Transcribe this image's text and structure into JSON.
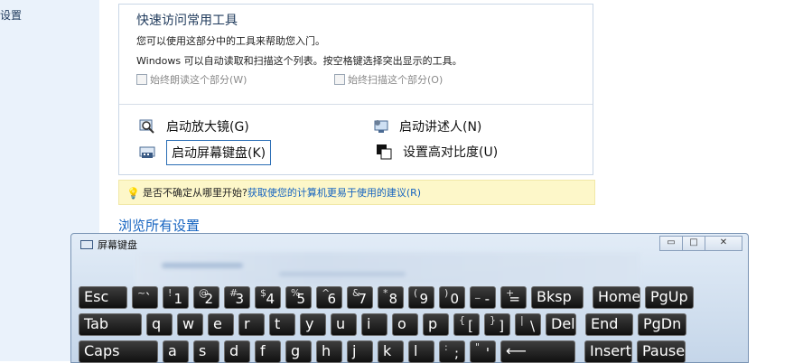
{
  "sidebar": {
    "label": "设置"
  },
  "quick_access": {
    "title": "快速访问常用工具",
    "line1": "您可以使用这部分中的工具来帮助您入门。",
    "line2": "Windows 可以自动读取和扫描这个列表。按空格键选择突出显示的工具。",
    "option_read": "始终朗读这个部分(W)",
    "option_scan": "始终扫描这个部分(O)",
    "tools": {
      "magnifier": "启动放大镜(G)",
      "narrator": "启动讲述人(N)",
      "osk": "启动屏幕键盘(K)",
      "contrast": "设置高对比度(U)"
    }
  },
  "hint": {
    "question": "是否不确定从哪里开始?",
    "link": "获取使您的计算机更易于使用的建议(R)"
  },
  "browse_all": "浏览所有设置",
  "osk_window": {
    "title": "屏幕键盘",
    "btn_min": "▭",
    "btn_max": "□",
    "btn_close": "✕"
  },
  "keyboard": {
    "row1": [
      {
        "top": "",
        "main": "Esc"
      },
      {
        "top": "~",
        "bot": "`"
      },
      {
        "top": "!",
        "bot": "1"
      },
      {
        "top": "@",
        "bot": "2"
      },
      {
        "top": "#",
        "bot": "3"
      },
      {
        "top": "$",
        "bot": "4"
      },
      {
        "top": "%",
        "bot": "5"
      },
      {
        "top": "^",
        "bot": "6"
      },
      {
        "top": "&",
        "bot": "7"
      },
      {
        "top": "*",
        "bot": "8"
      },
      {
        "top": "(",
        "bot": "9"
      },
      {
        "top": ")",
        "bot": "0"
      },
      {
        "top": "_",
        "bot": "-"
      },
      {
        "top": "+",
        "bot": "="
      },
      {
        "main": "Bksp"
      },
      {
        "main": "Home"
      },
      {
        "main": "PgUp"
      }
    ],
    "row2": [
      {
        "main": "Tab"
      },
      {
        "main": "q"
      },
      {
        "main": "w"
      },
      {
        "main": "e"
      },
      {
        "main": "r"
      },
      {
        "main": "t"
      },
      {
        "main": "y"
      },
      {
        "main": "u"
      },
      {
        "main": "i"
      },
      {
        "main": "o"
      },
      {
        "main": "p"
      },
      {
        "top": "{",
        "bot": "["
      },
      {
        "top": "}",
        "bot": "]"
      },
      {
        "top": "|",
        "bot": "\\"
      },
      {
        "main": "Del"
      },
      {
        "main": "End"
      },
      {
        "main": "PgDn"
      }
    ],
    "row3": [
      {
        "main": "Caps"
      },
      {
        "main": "a"
      },
      {
        "main": "s"
      },
      {
        "main": "d"
      },
      {
        "main": "f"
      },
      {
        "main": "g"
      },
      {
        "main": "h"
      },
      {
        "main": "j"
      },
      {
        "main": "k"
      },
      {
        "main": "l"
      },
      {
        "top": ":",
        "bot": ";"
      },
      {
        "top": "\"",
        "bot": "'"
      },
      {
        "main": "⟵"
      },
      {
        "main": "Insert"
      },
      {
        "main": "Pause"
      }
    ]
  }
}
